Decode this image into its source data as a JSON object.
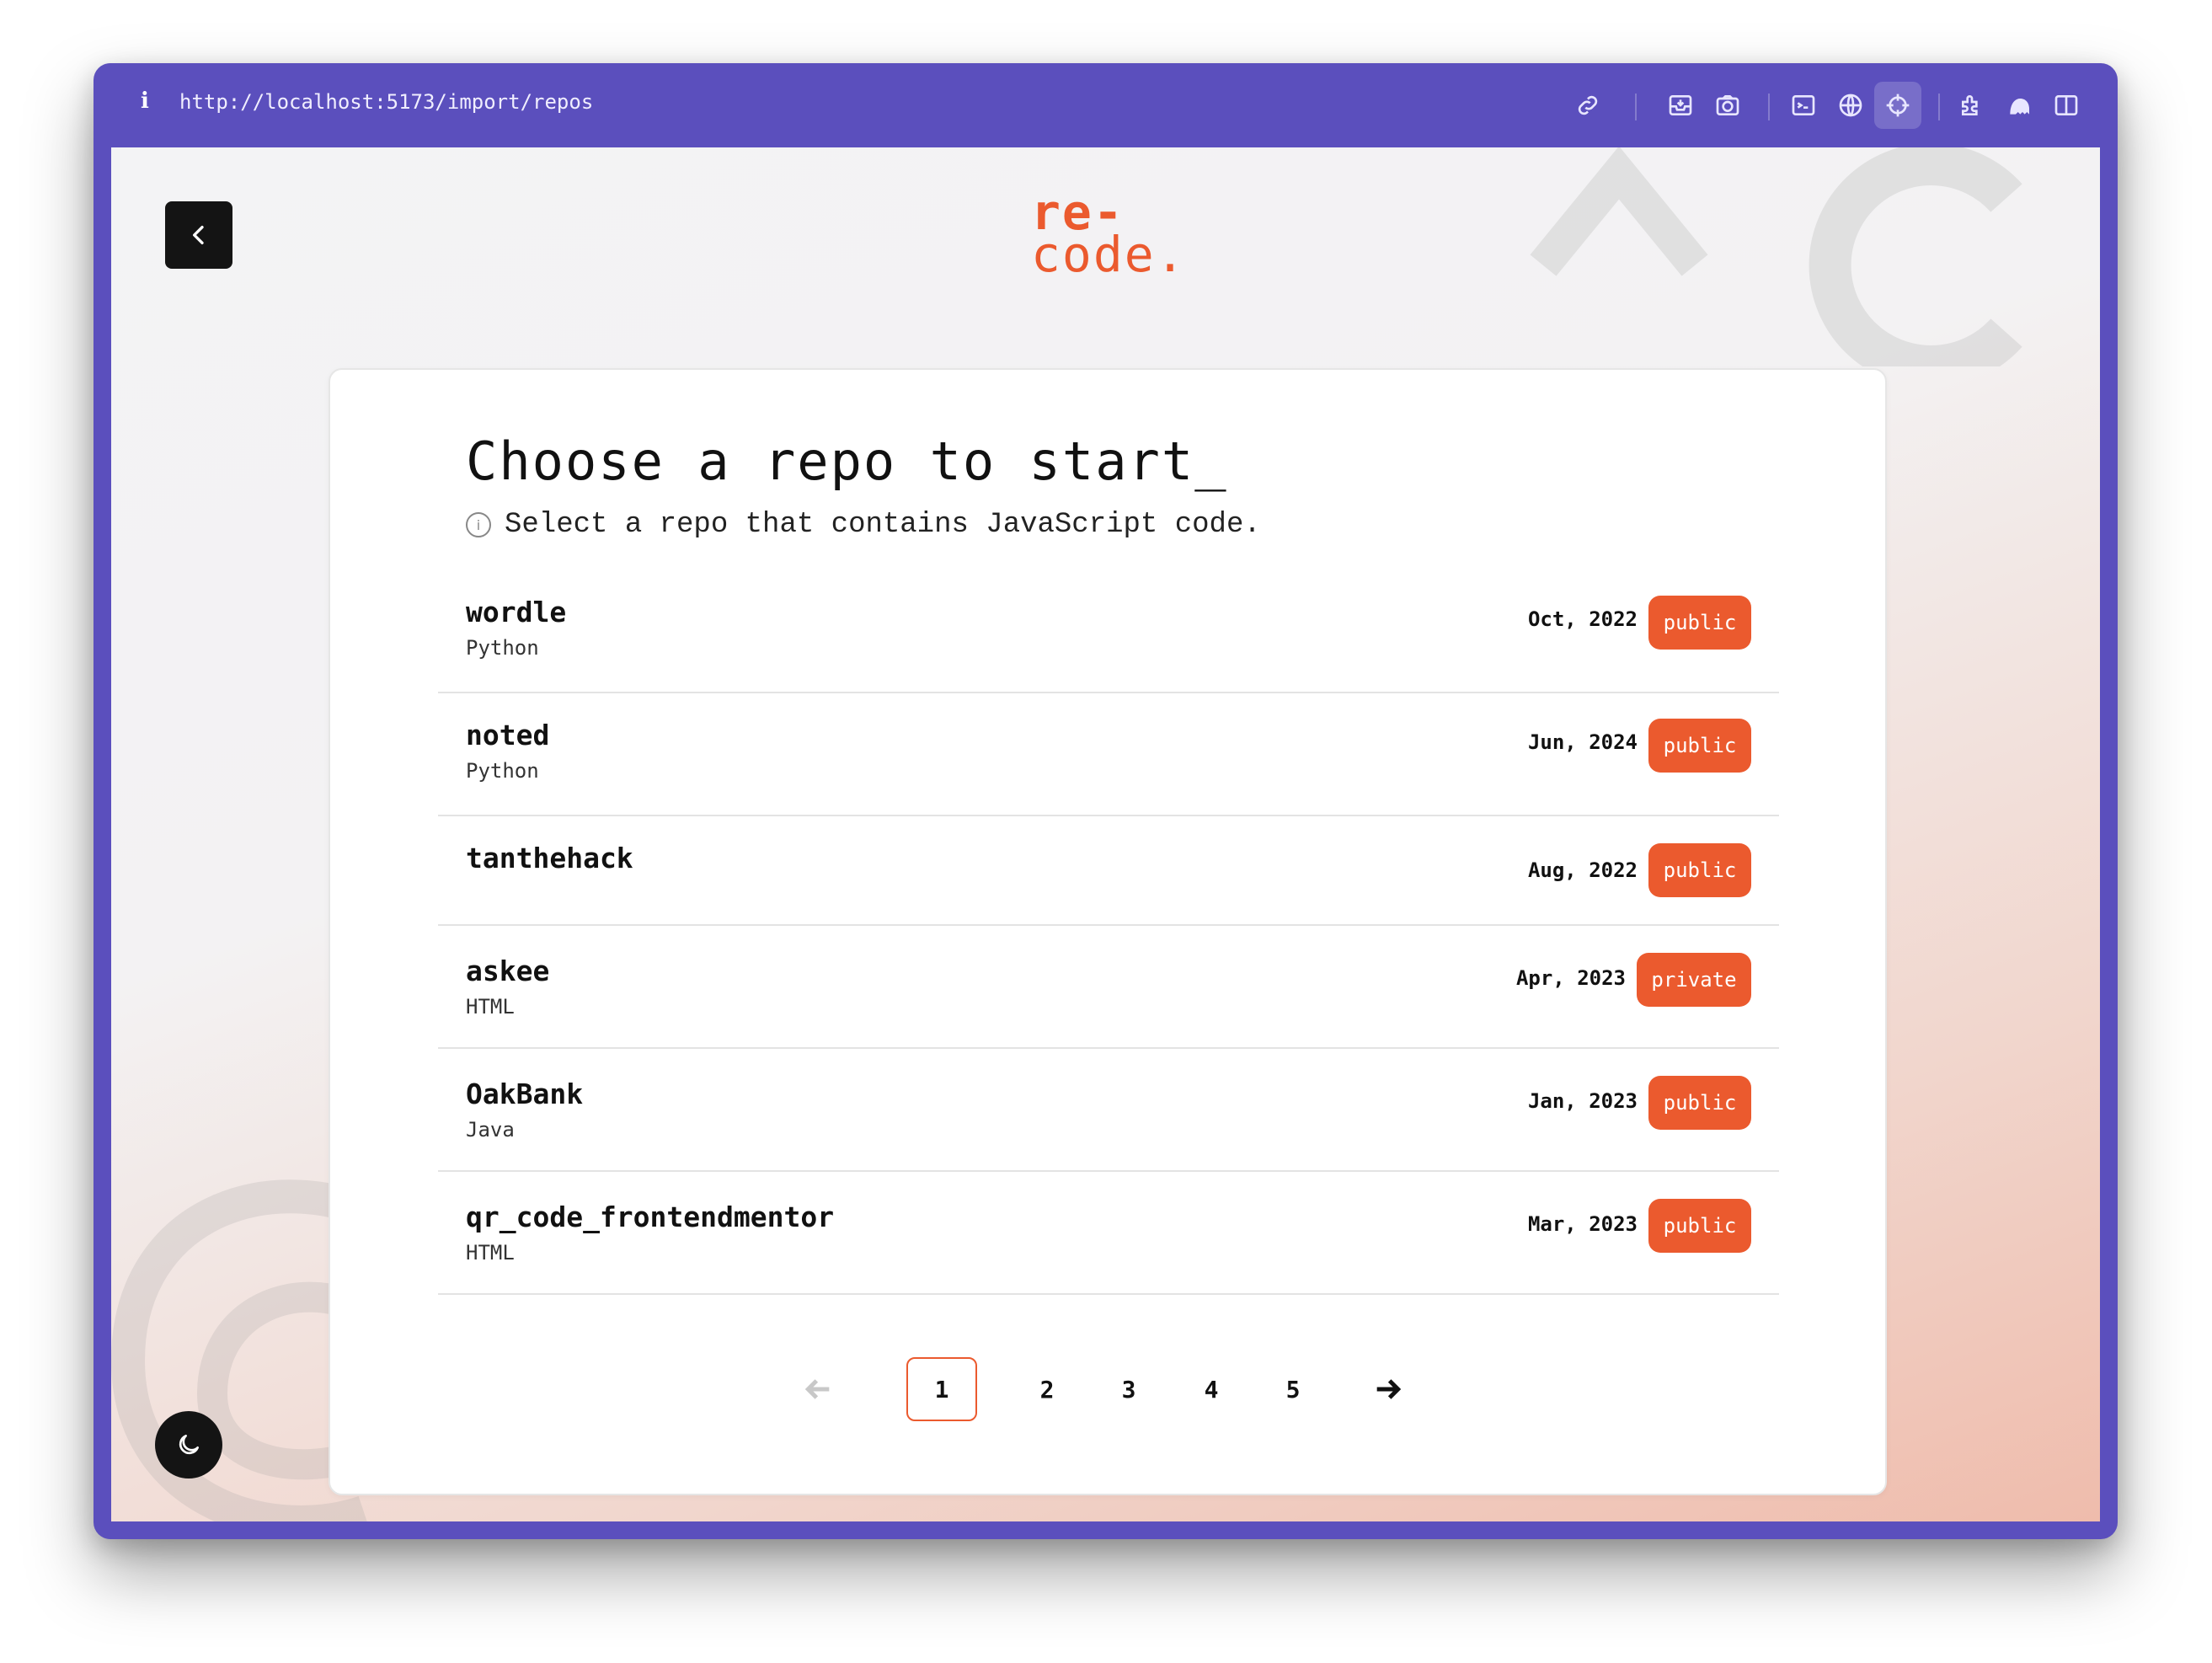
{
  "browser": {
    "info_label": "i",
    "url": "http://localhost:5173/import/repos",
    "toolbar_icons": [
      "link-icon",
      "inbox-icon",
      "camera-icon",
      "terminal-icon",
      "globe-icon",
      "crosshair-icon",
      "extension-icon",
      "ghost-icon",
      "sidebar-icon"
    ]
  },
  "page": {
    "logo_line1": "re-",
    "logo_line2": "code.",
    "title": "Choose a repo to start_",
    "subtitle": "Select a repo that contains JavaScript code.",
    "colors": {
      "accent": "#eb5a2e",
      "frame": "#5b4fbd",
      "dark": "#141414"
    }
  },
  "repos": [
    {
      "name": "wordle",
      "language": "Python",
      "date": "Oct, 2022",
      "visibility": "public"
    },
    {
      "name": "noted",
      "language": "Python",
      "date": "Jun, 2024",
      "visibility": "public"
    },
    {
      "name": "tanthehack",
      "language": "",
      "date": "Aug, 2022",
      "visibility": "public"
    },
    {
      "name": "askee",
      "language": "HTML",
      "date": "Apr, 2023",
      "visibility": "private"
    },
    {
      "name": "OakBank",
      "language": "Java",
      "date": "Jan, 2023",
      "visibility": "public"
    },
    {
      "name": "qr_code_frontendmentor",
      "language": "HTML",
      "date": "Mar, 2023",
      "visibility": "public"
    }
  ],
  "pagination": {
    "pages": [
      "1",
      "2",
      "3",
      "4",
      "5"
    ],
    "current": "1"
  }
}
